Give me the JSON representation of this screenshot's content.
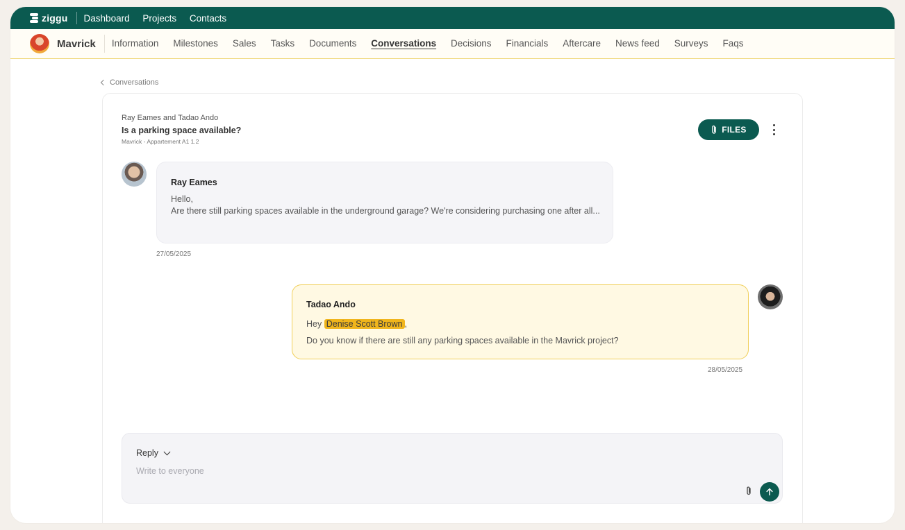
{
  "topbar": {
    "brand": "ziggu",
    "nav": [
      "Dashboard",
      "Projects",
      "Contacts"
    ]
  },
  "project": {
    "name": "Mavrick",
    "tabs": [
      "Information",
      "Milestones",
      "Sales",
      "Tasks",
      "Documents",
      "Conversations",
      "Decisions",
      "Financials",
      "Aftercare",
      "News feed",
      "Surveys",
      "Faqs"
    ],
    "active_tab": "Conversations"
  },
  "breadcrumb": {
    "label": "Conversations"
  },
  "conversation": {
    "participants": "Ray Eames and Tadao Ando",
    "title": "Is a parking space available?",
    "subtitle": "Mavrick - Appartement A1 1.2",
    "files_label": "FILES"
  },
  "messages": [
    {
      "sender": "Ray Eames",
      "line1": "Hello,",
      "line2": "Are there still parking spaces available in the underground garage? We're considering purchasing one after all...",
      "date": "27/05/2025"
    },
    {
      "sender": "Tadao Ando",
      "greeting": "Hey",
      "mention": "Denise Scott Brown",
      "after_mention": ",",
      "line2": "Do you know if there are still any parking spaces available in the Mavrick project?",
      "date": "28/05/2025"
    }
  ],
  "reply": {
    "label": "Reply",
    "placeholder": "Write to everyone"
  },
  "colors": {
    "brand": "#0b5a50",
    "mention": "#f0b51c",
    "own_bubble_border": "#f0cf5a"
  }
}
